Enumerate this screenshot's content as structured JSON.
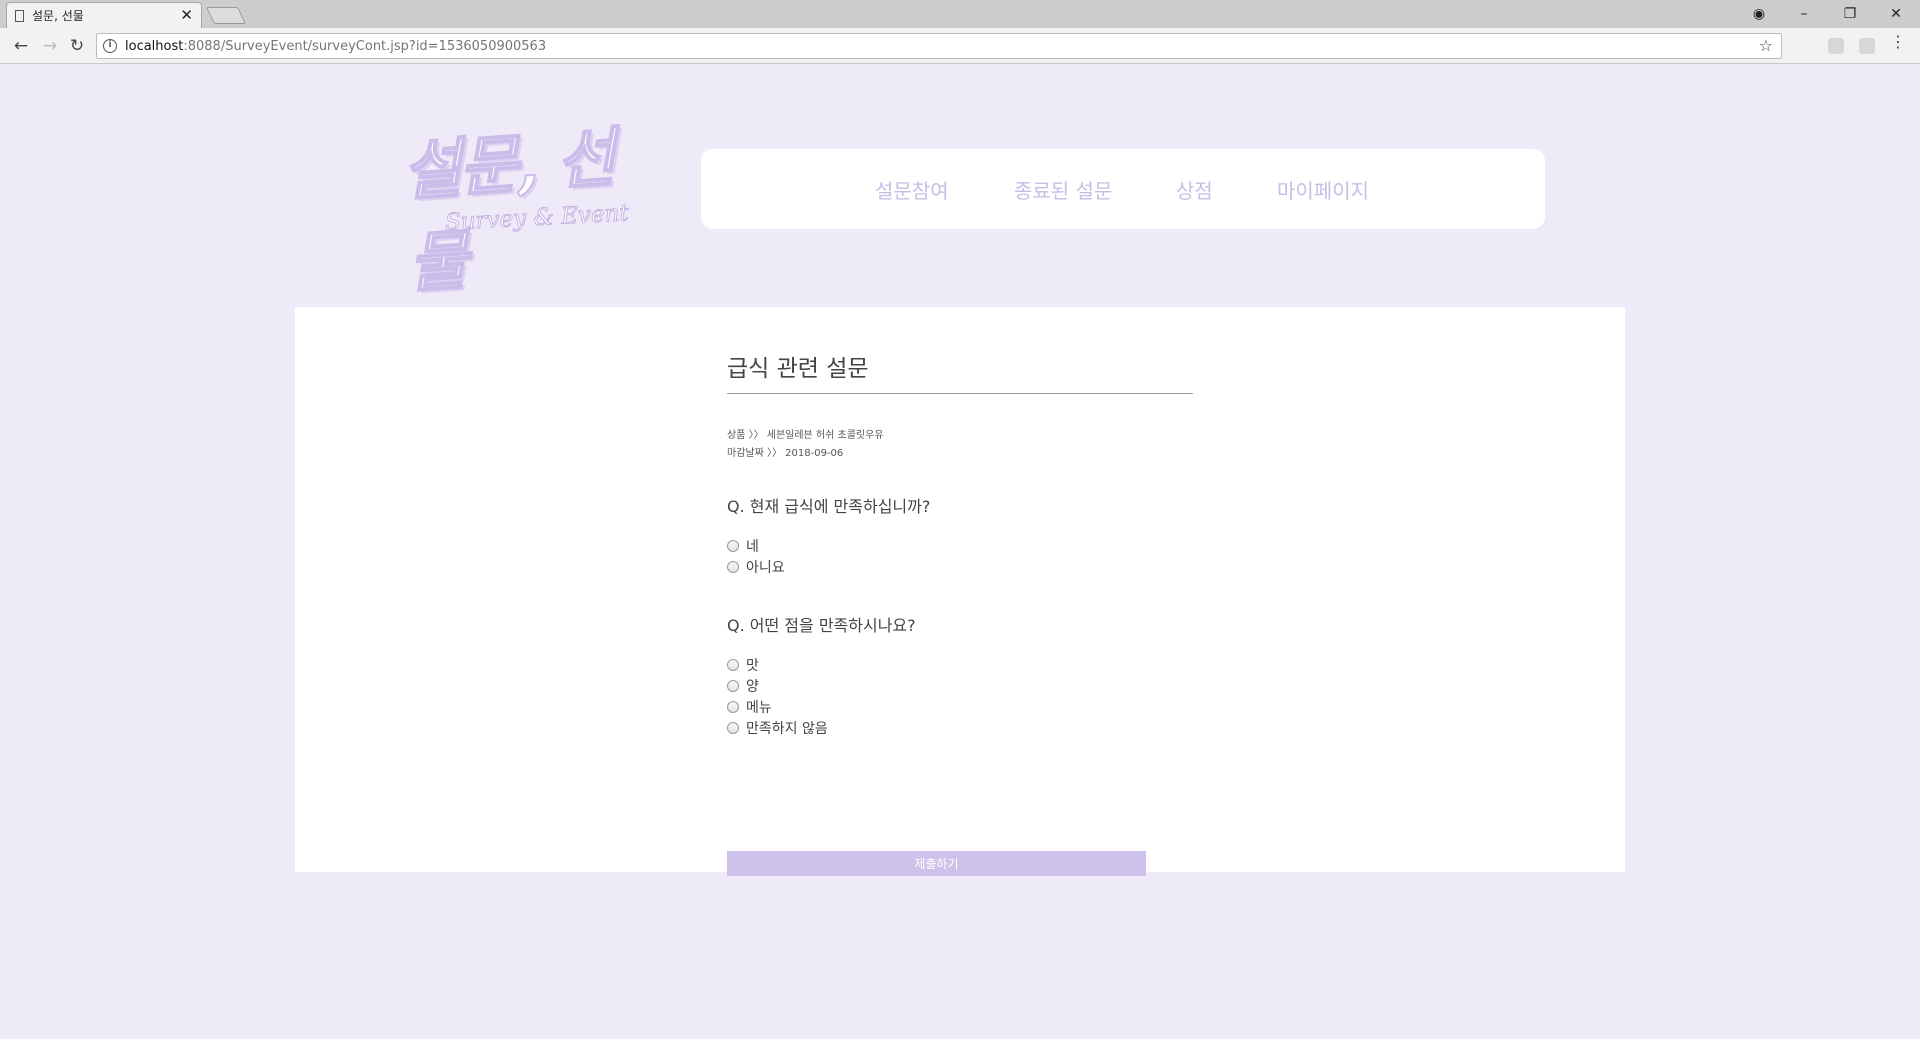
{
  "browser": {
    "tab_title": "설문, 선물",
    "tab_close": "✕",
    "url_host": "localhost",
    "url_rest": ":8088/SurveyEvent/surveyCont.jsp?id=1536050900563",
    "back_icon": "←",
    "forward_icon": "→",
    "reload_icon": "↻",
    "info_icon": "i",
    "star_icon": "☆",
    "menu_icon": "⋮",
    "profile_icon": "◉",
    "minimize_icon": "–",
    "restore_icon": "❐",
    "close_icon": "✕"
  },
  "logo": {
    "ko": "설문, 선물",
    "en": "Survey & Event"
  },
  "nav": {
    "items": [
      "설문참여",
      "종료된 설문",
      "상점",
      "마이페이지"
    ]
  },
  "survey": {
    "title": "급식 관련 설문",
    "prize_line": "상품 〉〉 세븐일레븐 허쉬 초콜릿우유",
    "deadline_line": "마감날짜 〉〉 2018-09-06",
    "questions": [
      {
        "text": "Q. 현재 급식에 만족하십니까?",
        "options": [
          "네",
          "아니요"
        ]
      },
      {
        "text": "Q. 어떤 점을 만족하시나요?",
        "options": [
          "맛",
          "양",
          "메뉴",
          "만족하지 않음"
        ]
      }
    ],
    "submit_label": "제출하기"
  },
  "colors": {
    "page_bg": "#efeaf7",
    "accent": "#cfc2ea",
    "nav_text": "#c9bde6"
  }
}
